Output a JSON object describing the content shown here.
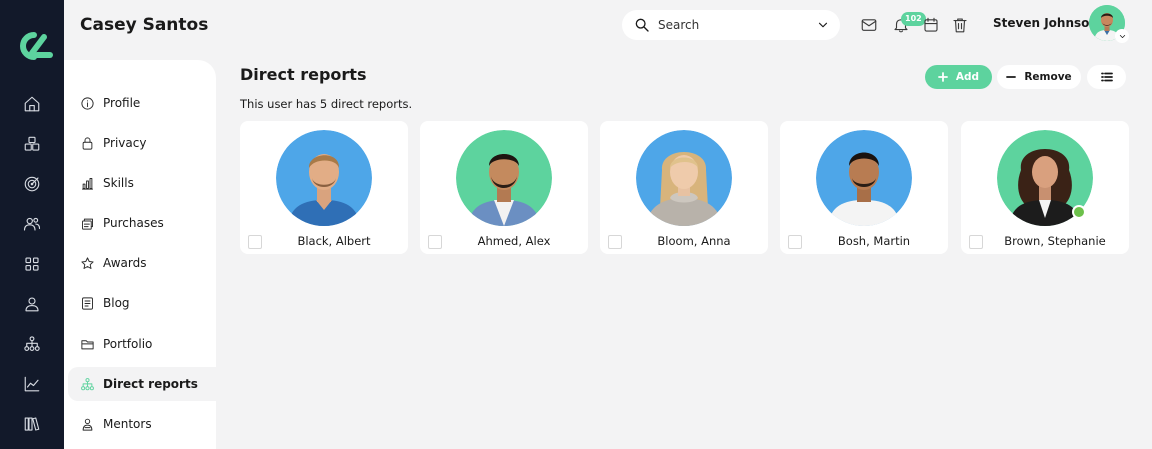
{
  "header": {
    "user_title": "Casey Santos",
    "search_placeholder": "Search",
    "notification_count": "102",
    "account_name": "Steven Johnson"
  },
  "rail": {
    "icons": [
      "home-icon",
      "layers-icon",
      "target-icon",
      "people-icon",
      "grid-icon",
      "user-icon",
      "org-chart-icon",
      "chart-icon",
      "library-icon"
    ]
  },
  "menu": {
    "items": [
      {
        "label": "Profile",
        "icon": "info-icon"
      },
      {
        "label": "Privacy",
        "icon": "lock-icon"
      },
      {
        "label": "Skills",
        "icon": "bar-chart-icon"
      },
      {
        "label": "Purchases",
        "icon": "purchases-icon"
      },
      {
        "label": "Awards",
        "icon": "star-icon"
      },
      {
        "label": "Blog",
        "icon": "blog-icon"
      },
      {
        "label": "Portfolio",
        "icon": "folder-icon"
      },
      {
        "label": "Direct reports",
        "icon": "org-icon",
        "active": true
      },
      {
        "label": "Mentors",
        "icon": "mentor-icon"
      }
    ]
  },
  "main": {
    "title": "Direct reports",
    "subtitle": "This user has 5 direct reports.",
    "add_label": "Add",
    "remove_label": "Remove",
    "reports": [
      {
        "name": "Black, Albert",
        "bg": "#4ea6e8"
      },
      {
        "name": "Ahmed, Alex",
        "bg": "#5dd39e"
      },
      {
        "name": "Bloom, Anna",
        "bg": "#4ea6e8"
      },
      {
        "name": "Bosh, Martin",
        "bg": "#4ea6e8"
      },
      {
        "name": "Brown, Stephanie",
        "bg": "#5dd39e",
        "online": true
      }
    ]
  },
  "colors": {
    "accent": "#5dd39e",
    "rail": "#12192a",
    "online": "#6cc04a"
  }
}
